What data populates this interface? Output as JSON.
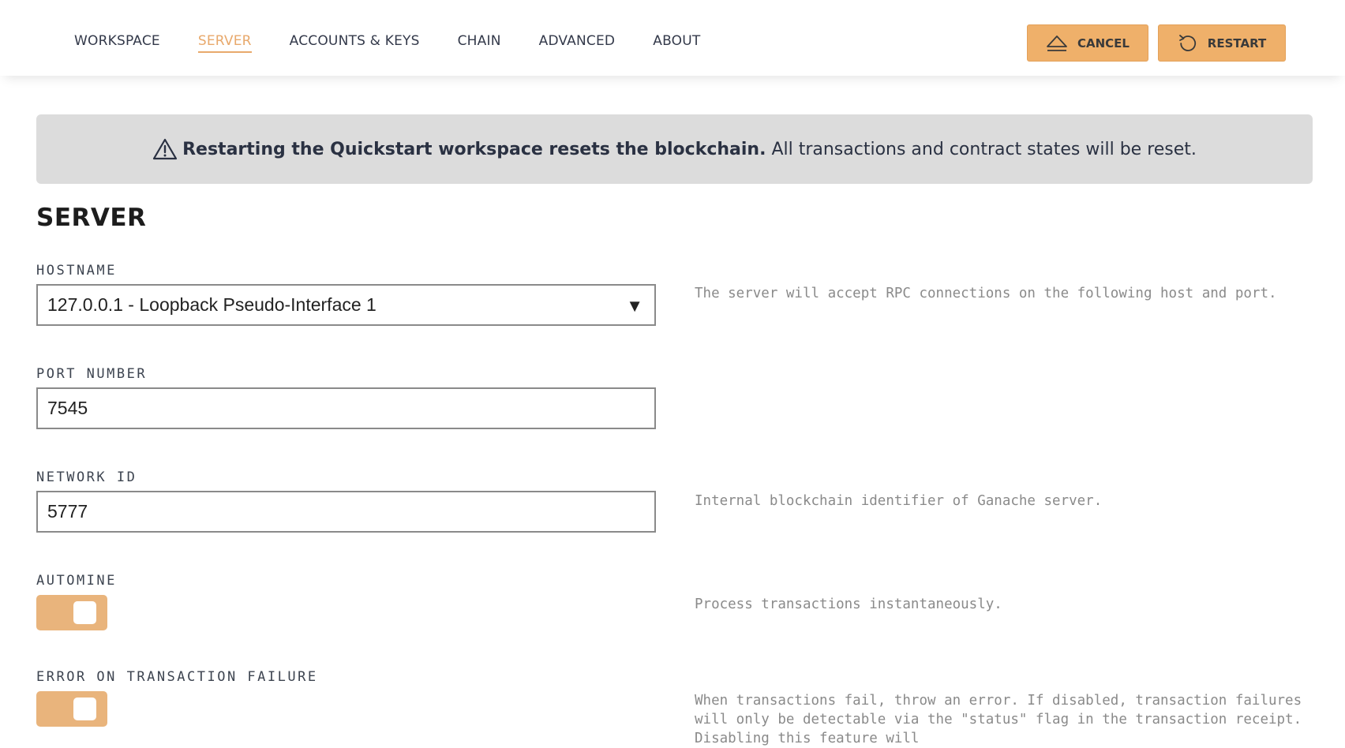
{
  "nav": {
    "tabs": [
      {
        "label": "WORKSPACE"
      },
      {
        "label": "SERVER"
      },
      {
        "label": "ACCOUNTS & KEYS"
      },
      {
        "label": "CHAIN"
      },
      {
        "label": "ADVANCED"
      },
      {
        "label": "ABOUT"
      }
    ],
    "active_tab": "SERVER",
    "cancel_label": "CANCEL",
    "restart_label": "RESTART"
  },
  "banner": {
    "icon": "warning-icon",
    "strong": "Restarting the Quickstart workspace resets the blockchain.",
    "rest": "All transactions and contract states will be reset."
  },
  "section": {
    "title": "SERVER"
  },
  "hostname": {
    "label": "HOSTNAME",
    "value": "127.0.0.1 - Loopback Pseudo-Interface 1",
    "help": "The server will accept RPC connections on the following host and port."
  },
  "port": {
    "label": "PORT NUMBER",
    "value": "7545"
  },
  "network_id": {
    "label": "NETWORK ID",
    "value": "5777",
    "help": "Internal blockchain identifier of Ganache server."
  },
  "automine": {
    "label": "AUTOMINE",
    "enabled": true,
    "help": "Process transactions instantaneously."
  },
  "error_on_failure": {
    "label": "ERROR ON TRANSACTION FAILURE",
    "enabled": true,
    "help": "When transactions fail, throw an error. If disabled, transaction failures will only be detectable via the \"status\" flag in the transaction receipt. Disabling this feature will"
  },
  "colors": {
    "accent": "#efb06a",
    "toggle_on": "#e9b47c",
    "banner_bg": "#dcdcdc"
  }
}
